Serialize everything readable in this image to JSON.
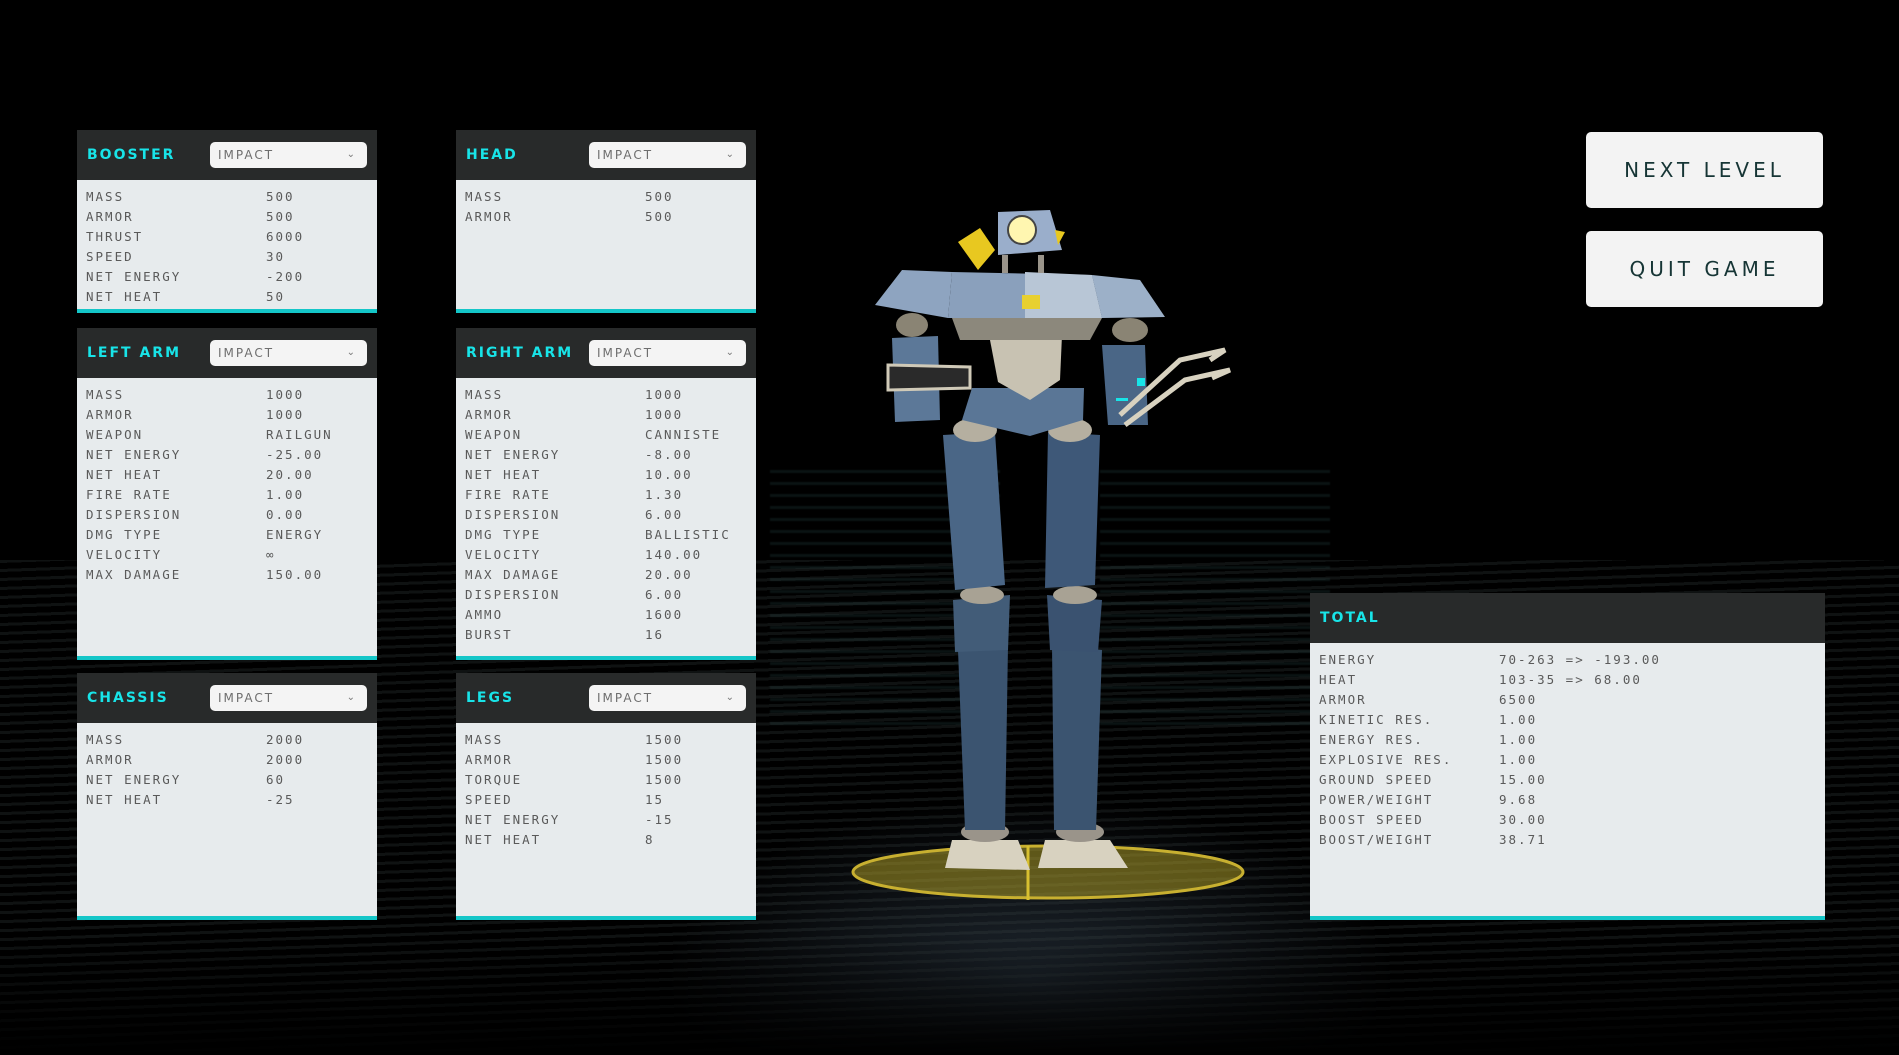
{
  "panels": {
    "booster": {
      "title": "BOOSTER",
      "selected": "IMPACT",
      "stats": [
        {
          "label": "MASS",
          "value": "500"
        },
        {
          "label": "ARMOR",
          "value": "500"
        },
        {
          "label": "THRUST",
          "value": "6000"
        },
        {
          "label": "SPEED",
          "value": "30"
        },
        {
          "label": "NET ENERGY",
          "value": "-200"
        },
        {
          "label": "NET HEAT",
          "value": "50"
        }
      ]
    },
    "head": {
      "title": "HEAD",
      "selected": "IMPACT",
      "stats": [
        {
          "label": "MASS",
          "value": "500"
        },
        {
          "label": "ARMOR",
          "value": "500"
        }
      ]
    },
    "left_arm": {
      "title": "LEFT ARM",
      "selected": "IMPACT",
      "stats": [
        {
          "label": "MASS",
          "value": "1000"
        },
        {
          "label": "ARMOR",
          "value": "1000"
        },
        {
          "label": "WEAPON",
          "value": "RAILGUN"
        },
        {
          "label": "NET ENERGY",
          "value": "-25.00"
        },
        {
          "label": "NET HEAT",
          "value": "20.00"
        },
        {
          "label": "FIRE RATE",
          "value": "1.00"
        },
        {
          "label": "DISPERSION",
          "value": "0.00"
        },
        {
          "label": "DMG TYPE",
          "value": "ENERGY"
        },
        {
          "label": "VELOCITY",
          "value": "∞"
        },
        {
          "label": "MAX DAMAGE",
          "value": "150.00"
        }
      ]
    },
    "right_arm": {
      "title": "RIGHT ARM",
      "selected": "IMPACT",
      "stats": [
        {
          "label": "MASS",
          "value": "1000"
        },
        {
          "label": "ARMOR",
          "value": "1000"
        },
        {
          "label": "WEAPON",
          "value": "CANNISTE"
        },
        {
          "label": "NET ENERGY",
          "value": "-8.00"
        },
        {
          "label": "NET HEAT",
          "value": "10.00"
        },
        {
          "label": "FIRE RATE",
          "value": "1.30"
        },
        {
          "label": "DISPERSION",
          "value": "6.00"
        },
        {
          "label": "DMG TYPE",
          "value": "BALLISTIC"
        },
        {
          "label": "VELOCITY",
          "value": "140.00"
        },
        {
          "label": "MAX DAMAGE",
          "value": "20.00"
        },
        {
          "label": "DISPERSION",
          "value": "6.00"
        },
        {
          "label": "AMMO",
          "value": "1600"
        },
        {
          "label": "BURST",
          "value": "16"
        }
      ]
    },
    "chassis": {
      "title": "CHASSIS",
      "selected": "IMPACT",
      "stats": [
        {
          "label": "MASS",
          "value": "2000"
        },
        {
          "label": "ARMOR",
          "value": "2000"
        },
        {
          "label": "NET ENERGY",
          "value": "60"
        },
        {
          "label": "NET HEAT",
          "value": "-25"
        }
      ]
    },
    "legs": {
      "title": "LEGS",
      "selected": "IMPACT",
      "stats": [
        {
          "label": "MASS",
          "value": "1500"
        },
        {
          "label": "ARMOR",
          "value": "1500"
        },
        {
          "label": "TORQUE",
          "value": "1500"
        },
        {
          "label": "SPEED",
          "value": "15"
        },
        {
          "label": "NET ENERGY",
          "value": "-15"
        },
        {
          "label": "NET HEAT",
          "value": "8"
        }
      ]
    },
    "total": {
      "title": "TOTAL",
      "stats": [
        {
          "label": "ENERGY",
          "value": "70-263 => -193.00"
        },
        {
          "label": "HEAT",
          "value": "103-35 => 68.00"
        },
        {
          "label": "ARMOR",
          "value": "6500"
        },
        {
          "label": "KINETIC RES.",
          "value": "1.00"
        },
        {
          "label": "ENERGY RES.",
          "value": "1.00"
        },
        {
          "label": "EXPLOSIVE RES.",
          "value": "1.00"
        },
        {
          "label": "GROUND SPEED",
          "value": "15.00"
        },
        {
          "label": "POWER/WEIGHT",
          "value": "9.68"
        },
        {
          "label": "BOOST SPEED",
          "value": "30.00"
        },
        {
          "label": "BOOST/WEIGHT",
          "value": "38.71"
        }
      ]
    }
  },
  "buttons": {
    "next_level": "NEXT LEVEL",
    "quit_game": "QUIT GAME"
  },
  "icons": {
    "dropdown": "chevron-down-icon"
  },
  "colors": {
    "accent": "#18e4e8",
    "panel_header": "#282a2a",
    "panel_body": "#e7ebed",
    "panel_border": "#14c6c8",
    "button_bg": "#f3f3f3",
    "button_text": "#163535"
  }
}
